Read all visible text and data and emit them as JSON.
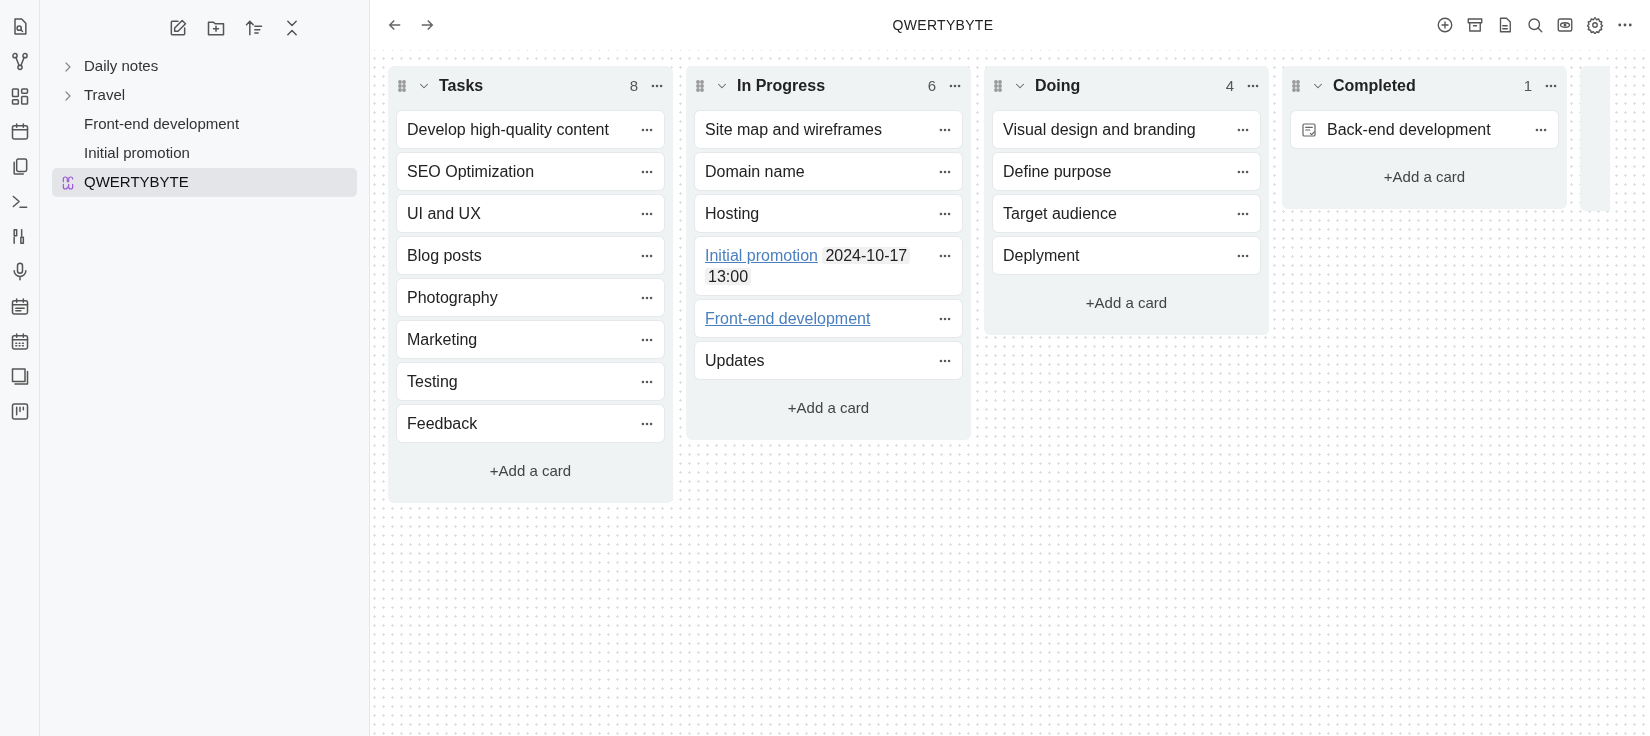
{
  "window": {
    "title": "QWERTYBYTE"
  },
  "sidebar": {
    "items": [
      {
        "label": "Daily notes",
        "kind": "folder",
        "expanded": false,
        "selected": false
      },
      {
        "label": "Travel",
        "kind": "folder",
        "expanded": false,
        "selected": false
      },
      {
        "label": "Front-end development",
        "kind": "file",
        "selected": false
      },
      {
        "label": "Initial promotion",
        "kind": "file",
        "selected": false
      },
      {
        "label": "QWERTYBYTE",
        "kind": "board",
        "selected": true
      }
    ]
  },
  "board": {
    "lanes": [
      {
        "title": "Tasks",
        "count": "8",
        "add_label": "+Add a card",
        "cards": [
          {
            "kind": "plain",
            "text": "Develop high-quality content"
          },
          {
            "kind": "plain",
            "text": "SEO Optimization"
          },
          {
            "kind": "plain",
            "text": "UI and UX"
          },
          {
            "kind": "plain",
            "text": "Blog posts"
          },
          {
            "kind": "plain",
            "text": "Photography"
          },
          {
            "kind": "plain",
            "text": "Marketing"
          },
          {
            "kind": "plain",
            "text": "Testing"
          },
          {
            "kind": "plain",
            "text": "Feedback"
          }
        ]
      },
      {
        "title": "In Progress",
        "count": "6",
        "add_label": "+Add a card",
        "cards": [
          {
            "kind": "plain",
            "text": "Site map and wireframes"
          },
          {
            "kind": "plain",
            "text": "Domain name"
          },
          {
            "kind": "plain",
            "text": "Hosting"
          },
          {
            "kind": "link",
            "text": "Initial promotion",
            "date": "2024-10-17",
            "time": "13:00"
          },
          {
            "kind": "link",
            "text": "Front-end development"
          },
          {
            "kind": "plain",
            "text": "Updates"
          }
        ]
      },
      {
        "title": "Doing",
        "count": "4",
        "add_label": "+Add a card",
        "cards": [
          {
            "kind": "plain",
            "text": "Visual design and branding"
          },
          {
            "kind": "plain",
            "text": "Define purpose"
          },
          {
            "kind": "plain",
            "text": "Target audience"
          },
          {
            "kind": "plain",
            "text": "Deplyment"
          }
        ]
      },
      {
        "title": "Completed",
        "count": "1",
        "add_label": "+Add a card",
        "cards": [
          {
            "kind": "archived",
            "text": "Back-end development"
          }
        ]
      }
    ]
  }
}
